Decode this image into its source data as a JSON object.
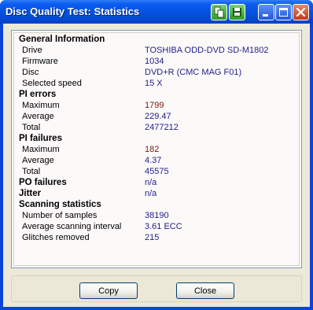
{
  "window": {
    "title": "Disc Quality Test: Statistics"
  },
  "sections": {
    "general": "General Information",
    "pi_errors": "PI errors",
    "pi_failures": "PI failures",
    "po_failures": "PO failures",
    "jitter": "Jitter",
    "scanning": "Scanning statistics"
  },
  "general": {
    "drive_label": "Drive",
    "drive_value": "TOSHIBA ODD-DVD SD-M1802",
    "firmware_label": "Firmware",
    "firmware_value": "1034",
    "disc_label": "Disc",
    "disc_value": "DVD+R (CMC MAG F01)",
    "speed_label": "Selected speed",
    "speed_value": "15 X"
  },
  "pi_errors": {
    "max_label": "Maximum",
    "max_value": "1799",
    "avg_label": "Average",
    "avg_value": "229.47",
    "total_label": "Total",
    "total_value": "2477212"
  },
  "pi_failures": {
    "max_label": "Maximum",
    "max_value": "182",
    "avg_label": "Average",
    "avg_value": "4.37",
    "total_label": "Total",
    "total_value": "45575"
  },
  "po_failures_value": "n/a",
  "jitter_value": "n/a",
  "scanning": {
    "samples_label": "Number of samples",
    "samples_value": "38190",
    "interval_label": "Average scanning interval",
    "interval_value": "3.61 ECC",
    "glitches_label": "Glitches removed",
    "glitches_value": "215"
  },
  "buttons": {
    "copy": "Copy",
    "close": "Close"
  },
  "colors": {
    "value_text": "#1e1e8c",
    "highlight_value": "#7a1a10",
    "titlebar": "#0553e0"
  },
  "icons": {
    "titlebar_left": "copy-to-clipboard-icon",
    "titlebar_right": "save-icon",
    "minimize": "minimize-icon",
    "maximize": "maximize-icon",
    "close": "close-icon"
  }
}
